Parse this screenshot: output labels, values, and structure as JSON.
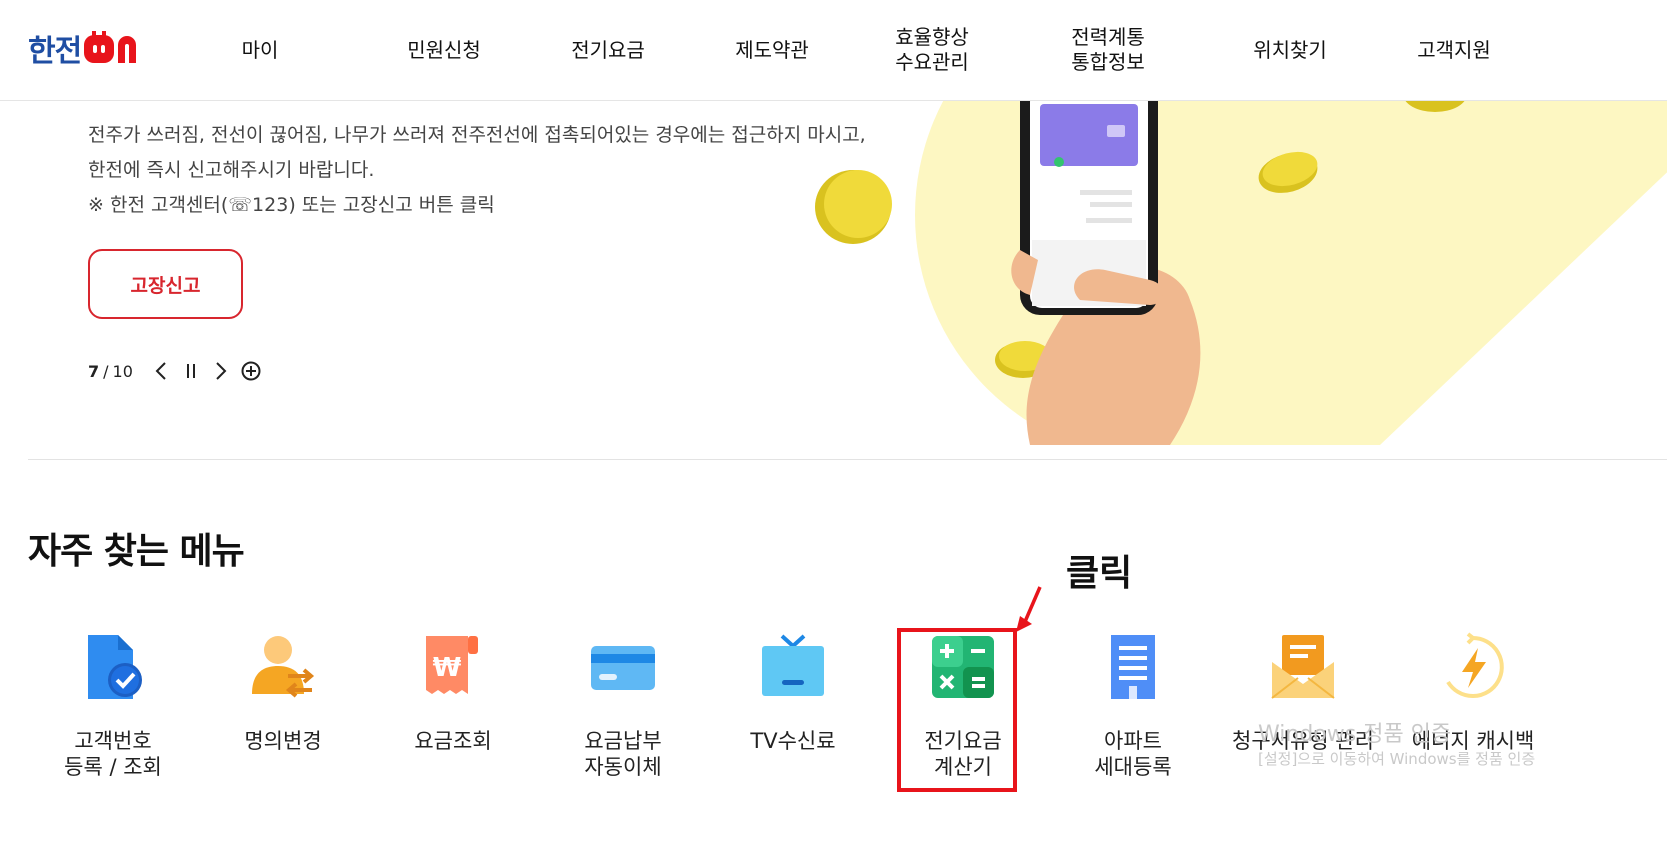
{
  "header": {
    "logo_text": "한전",
    "nav": [
      {
        "label": "마이"
      },
      {
        "label": "민원신청"
      },
      {
        "label": "전기요금"
      },
      {
        "label": "제도약관"
      },
      {
        "label": "효율향상\n수요관리"
      },
      {
        "label": "전력계통\n통합정보"
      },
      {
        "label": "위치찾기"
      },
      {
        "label": "고객지원"
      }
    ]
  },
  "hero": {
    "lines": [
      "전주가 쓰러짐, 전선이 끊어짐, 나무가 쓰러져 전주전선에 접촉되어있는 경우에는 접근하지 마시고,",
      "한전에 즉시 신고해주시기 바랍니다.",
      "※ 한전 고객센터(☏123) 또는 고장신고 버튼 클릭"
    ],
    "report_button": "고장신고",
    "pager": {
      "current": "7",
      "separator": "/",
      "total": "10"
    }
  },
  "frequent_menu": {
    "title": "자주 찾는 메뉴",
    "annotation": "클릭",
    "items": [
      {
        "label": "고객번호\n등록 / 조회",
        "icon": "document-check-icon"
      },
      {
        "label": "명의변경",
        "icon": "person-transfer-icon"
      },
      {
        "label": "요금조회",
        "icon": "receipt-won-icon"
      },
      {
        "label": "요금납부\n자동이체",
        "icon": "credit-card-icon"
      },
      {
        "label": "TV수신료",
        "icon": "tv-icon"
      },
      {
        "label": "전기요금\n계산기",
        "icon": "calculator-icon"
      },
      {
        "label": "아파트\n세대등록",
        "icon": "apartment-icon"
      },
      {
        "label": "청구서유형 관리",
        "icon": "envelope-icon"
      },
      {
        "label": "에너지 캐시백",
        "icon": "lightning-icon"
      }
    ]
  },
  "watermark": {
    "line1": "Windows 정품 인증",
    "line2": "[설정]으로 이동하여 Windows를 정품 인증"
  },
  "colors": {
    "brand_blue": "#1f4ea3",
    "brand_red": "#e8141b",
    "accent_red": "#d8262e"
  }
}
